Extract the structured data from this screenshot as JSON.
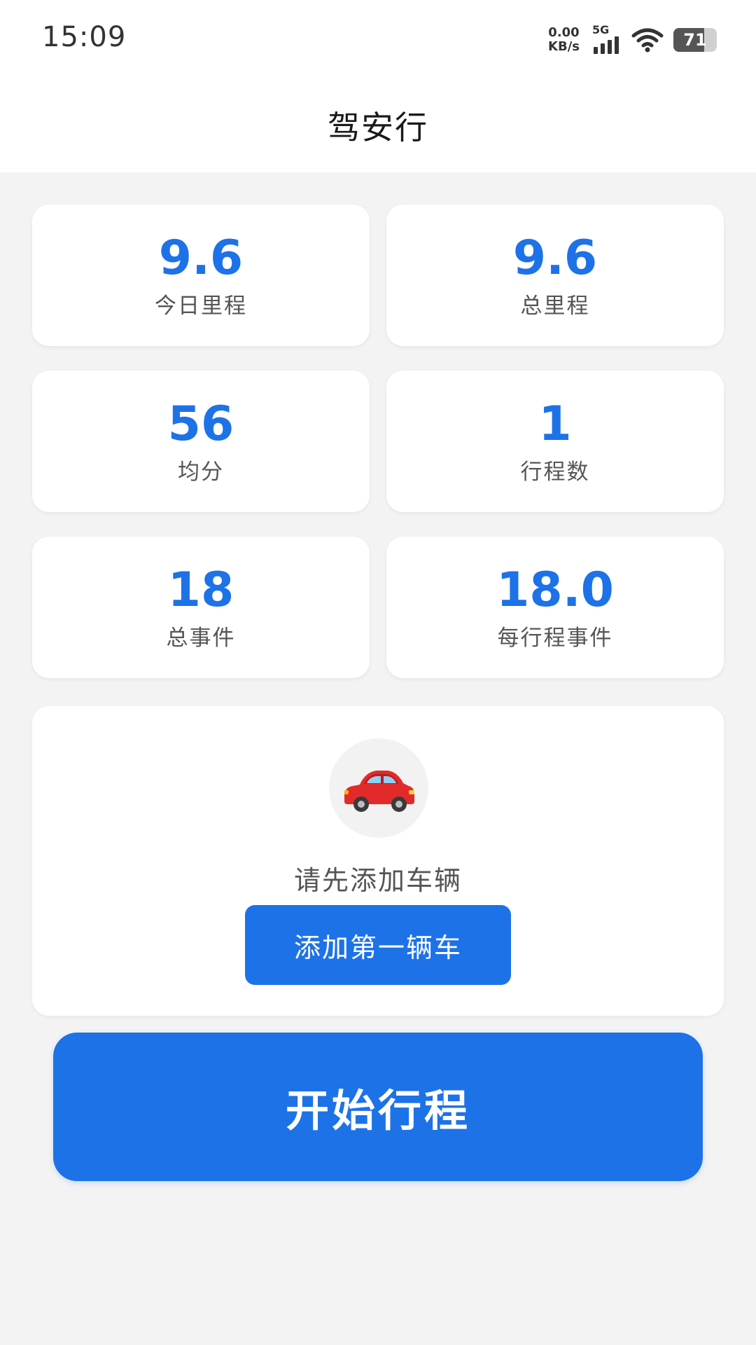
{
  "status_bar": {
    "time": "15:09",
    "net_speed_value": "0.00",
    "net_speed_unit": "KB/s",
    "signal_label": "5G",
    "battery_level": "71",
    "battery_fraction": 0.71
  },
  "header": {
    "title": "驾安行"
  },
  "stats": [
    {
      "value": "9.6",
      "label": "今日里程"
    },
    {
      "value": "9.6",
      "label": "总里程"
    },
    {
      "value": "56",
      "label": "均分"
    },
    {
      "value": "1",
      "label": "行程数"
    },
    {
      "value": "18",
      "label": "总事件"
    },
    {
      "value": "18.0",
      "label": "每行程事件"
    }
  ],
  "vehicle": {
    "icon": "car-icon",
    "prompt": "请先添加车辆",
    "add_button_label": "添加第一辆车"
  },
  "start_button_label": "开始行程",
  "colors": {
    "accent": "#1d72e8",
    "background": "#f3f3f3",
    "card": "#ffffff",
    "car_red": "#e32a2a"
  }
}
